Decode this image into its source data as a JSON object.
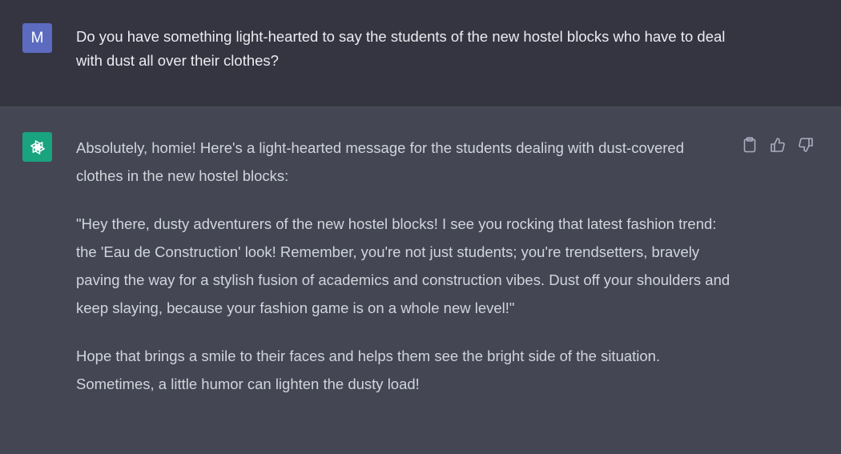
{
  "user_message": {
    "avatar_letter": "M",
    "text": "Do you have something light-hearted to say the students of the new hostel blocks who have to deal with dust all over their clothes?"
  },
  "assistant_message": {
    "avatar_icon": "openai-logo-icon",
    "paragraphs": [
      "Absolutely, homie! Here's a light-hearted message for the students dealing with dust-covered clothes in the new hostel blocks:",
      "\"Hey there, dusty adventurers of the new hostel blocks! I see you rocking that latest fashion trend: the 'Eau de Construction' look! Remember, you're not just students; you're trendsetters, bravely paving the way for a stylish fusion of academics and construction vibes. Dust off your shoulders and keep slaying, because your fashion game is on a whole new level!\"",
      "Hope that brings a smile to their faces and helps them see the bright side of the situation. Sometimes, a little humor can lighten the dusty load!"
    ],
    "actions": [
      "clipboard-icon",
      "thumbs-up-icon",
      "thumbs-down-icon"
    ]
  },
  "colors": {
    "user_bg": "#343541",
    "assistant_bg": "#444654",
    "user_avatar": "#5c6bc0",
    "gpt_avatar": "#19a37f"
  }
}
